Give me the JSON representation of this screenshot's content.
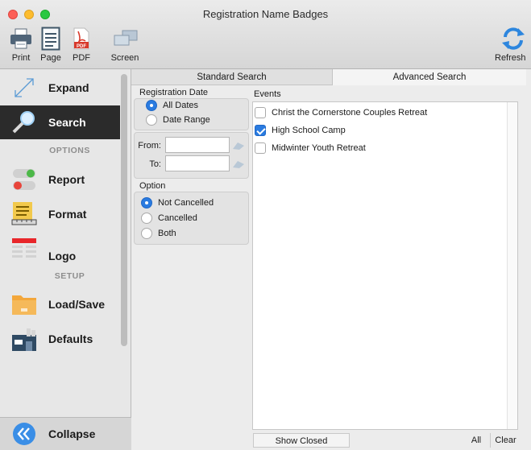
{
  "window": {
    "title": "Registration Name Badges"
  },
  "toolbar": {
    "print": "Print",
    "page": "Page",
    "pdf": "PDF",
    "pdf_badge": "PDF",
    "screen": "Screen",
    "refresh": "Refresh"
  },
  "sidebar": {
    "expand": "Expand",
    "search": "Search",
    "options_header": "OPTIONS",
    "report": "Report",
    "format": "Format",
    "logo": "Logo",
    "setup_header": "SETUP",
    "load_save": "Load/Save",
    "defaults": "Defaults",
    "collapse": "Collapse"
  },
  "tabs": {
    "standard": "Standard Search",
    "advanced": "Advanced Search"
  },
  "registration_date": {
    "label": "Registration Date",
    "options": [
      "All Dates",
      "Date Range"
    ],
    "selected": "All Dates",
    "from_label": "From:",
    "to_label": "To:",
    "from_value": "",
    "to_value": ""
  },
  "option": {
    "label": "Option",
    "options": [
      "Not Cancelled",
      "Cancelled",
      "Both"
    ],
    "selected": "Not Cancelled"
  },
  "events": {
    "label": "Events",
    "items": [
      {
        "name": "Christ the Cornerstone Couples Retreat",
        "checked": false
      },
      {
        "name": "High School Camp",
        "checked": true
      },
      {
        "name": "Midwinter Youth Retreat",
        "checked": false
      }
    ]
  },
  "buttons": {
    "show_closed": "Show Closed",
    "all": "All",
    "clear": "Clear"
  },
  "colors": {
    "accent": "#2a7be0",
    "active_sidebar": "#2b2b2b",
    "collapse_icon": "#3a8ee6"
  }
}
